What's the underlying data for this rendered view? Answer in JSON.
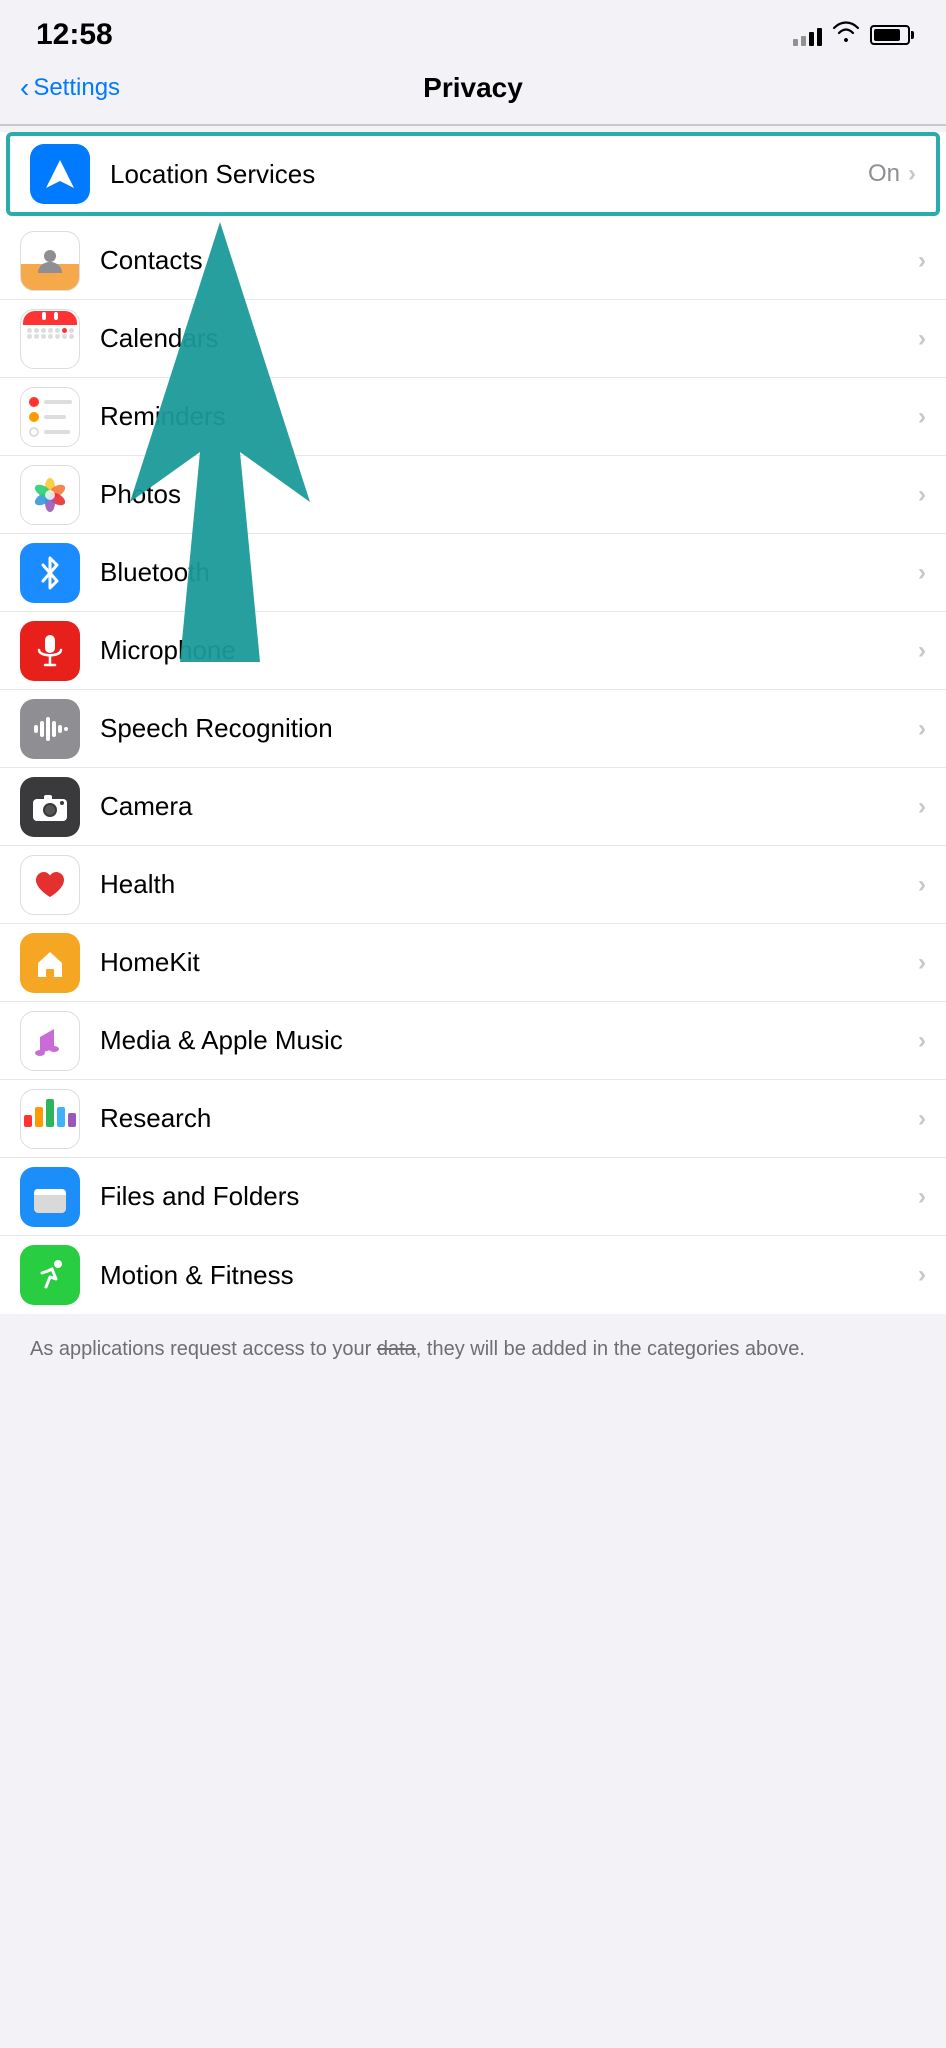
{
  "statusBar": {
    "time": "12:58",
    "signal": [
      4,
      8,
      12,
      16,
      20
    ],
    "battery_label": "battery"
  },
  "header": {
    "back_label": "Settings",
    "title": "Privacy"
  },
  "items": [
    {
      "id": "location-services",
      "label": "Location Services",
      "value": "On",
      "icon": "location",
      "highlighted": true
    },
    {
      "id": "contacts",
      "label": "Contacts",
      "value": "",
      "icon": "contacts",
      "highlighted": false
    },
    {
      "id": "calendars",
      "label": "Calendars",
      "value": "",
      "icon": "calendar",
      "highlighted": false
    },
    {
      "id": "reminders",
      "label": "Reminders",
      "value": "",
      "icon": "reminders",
      "highlighted": false
    },
    {
      "id": "photos",
      "label": "Photos",
      "value": "",
      "icon": "photos",
      "highlighted": false
    },
    {
      "id": "bluetooth",
      "label": "Bluetooth",
      "value": "",
      "icon": "bluetooth",
      "highlighted": false
    },
    {
      "id": "microphone",
      "label": "Microphone",
      "value": "",
      "icon": "microphone",
      "highlighted": false
    },
    {
      "id": "speech-recognition",
      "label": "Speech Recognition",
      "value": "",
      "icon": "speech",
      "highlighted": false
    },
    {
      "id": "camera",
      "label": "Camera",
      "value": "",
      "icon": "camera",
      "highlighted": false
    },
    {
      "id": "health",
      "label": "Health",
      "value": "",
      "icon": "health",
      "highlighted": false
    },
    {
      "id": "homekit",
      "label": "HomeKit",
      "value": "",
      "icon": "homekit",
      "highlighted": false
    },
    {
      "id": "media-apple-music",
      "label": "Media & Apple Music",
      "value": "",
      "icon": "music",
      "highlighted": false
    },
    {
      "id": "research",
      "label": "Research",
      "value": "",
      "icon": "research",
      "highlighted": false
    },
    {
      "id": "files-folders",
      "label": "Files and Folders",
      "value": "",
      "icon": "files",
      "highlighted": false
    },
    {
      "id": "motion-fitness",
      "label": "Motion & Fitness",
      "value": "",
      "icon": "fitness",
      "highlighted": false
    }
  ],
  "footer": {
    "text": "As applications request access to your data, they will be added in the categories above."
  }
}
